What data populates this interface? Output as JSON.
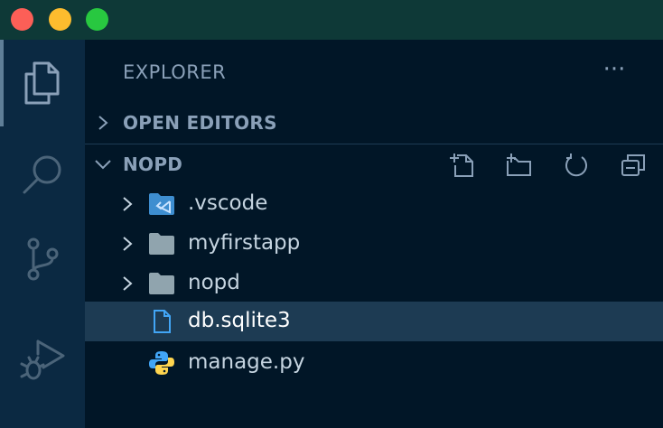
{
  "window": {
    "controls": [
      "close",
      "minimize",
      "maximize"
    ]
  },
  "activity_bar": {
    "items": [
      {
        "icon": "files-icon",
        "active": true
      },
      {
        "icon": "search-icon"
      },
      {
        "icon": "source-control-icon"
      },
      {
        "icon": "run-debug-icon"
      }
    ]
  },
  "explorer": {
    "title": "EXPLORER",
    "more_label": "···",
    "open_editors_label": "OPEN EDITORS",
    "folder_label": "NOPD",
    "folder_actions": [
      "new-file-icon",
      "new-folder-icon",
      "refresh-icon",
      "collapse-all-icon"
    ],
    "items": [
      {
        "name": ".vscode",
        "type": "folder",
        "icon": "vscode-folder-icon"
      },
      {
        "name": "myfirstapp",
        "type": "folder",
        "icon": "folder-icon"
      },
      {
        "name": "nopd",
        "type": "folder",
        "icon": "folder-icon"
      },
      {
        "name": "db.sqlite3",
        "type": "file",
        "icon": "file-icon",
        "selected": true
      },
      {
        "name": "manage.py",
        "type": "file",
        "icon": "python-icon"
      }
    ]
  },
  "colors": {
    "titlebar": "#0e3937",
    "activity_bar": "#0b2942",
    "sidebar": "#011627",
    "selection": "#1d3b53",
    "text": "#c5d4e0",
    "muted": "#8aa0b8"
  }
}
